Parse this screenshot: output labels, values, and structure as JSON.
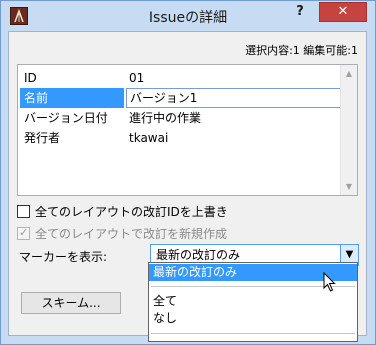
{
  "window": {
    "title": "Issueの詳細",
    "help_label": "?",
    "close_label": "✕"
  },
  "selection_info": "選択内容:1 編集可能:1",
  "properties": [
    {
      "key": "ID",
      "value": "01"
    },
    {
      "key": "名前",
      "value": "バージョン1",
      "selected": true
    },
    {
      "key": "バージョン日付",
      "value": "進行中の作業"
    },
    {
      "key": "発行者",
      "value": "tkawai"
    }
  ],
  "scrollbar": {
    "up": "▲",
    "down": "▼"
  },
  "options": {
    "overwrite_revision_id": {
      "label": "全てのレイアウトの改訂IDを上書き",
      "checked": false,
      "enabled": true
    },
    "create_new_revision": {
      "label": "全てのレイアウトで改訂を新規作成",
      "checked": true,
      "enabled": false,
      "check_glyph": "✓"
    }
  },
  "marker": {
    "label": "マーカーを表示:",
    "selected": "最新の改訂のみ",
    "arrow": "▼",
    "options": [
      "最新の改訂のみ",
      "全て",
      "なし"
    ]
  },
  "scheme_button": "スキーム..."
}
